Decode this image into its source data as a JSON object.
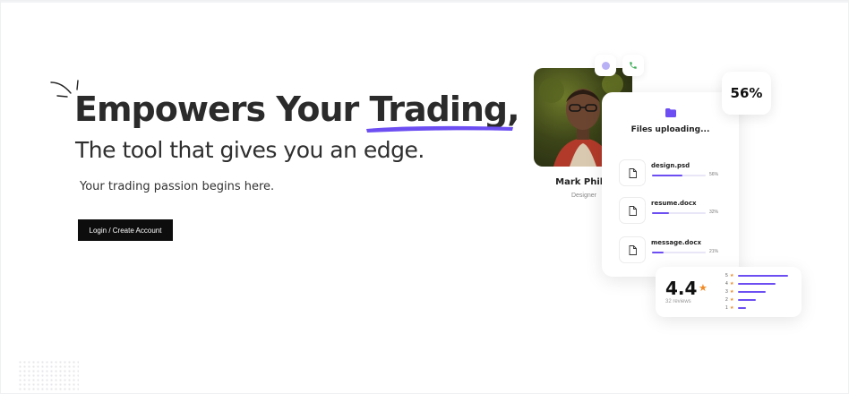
{
  "hero": {
    "headline_prefix": "Empowers Your ",
    "headline_highlight": "Trading",
    "headline_suffix": ",",
    "subheadline": "The tool that gives you an edge.",
    "tagline": "Your trading passion begins here.",
    "cta_label": "Login / Create Account"
  },
  "profile": {
    "name": "Mark Philip",
    "role": "Designer"
  },
  "upload": {
    "title": "Files uploading...",
    "percent_badge": "56%",
    "files": [
      {
        "name": "design.psd",
        "percent_label": "56%",
        "progress": 0.56
      },
      {
        "name": "resume.docx",
        "percent_label": "32%",
        "progress": 0.32
      },
      {
        "name": "message.docx",
        "percent_label": "21%",
        "progress": 0.21
      }
    ]
  },
  "reviews": {
    "rating": "4.4",
    "count_label": "32 reviews",
    "distribution": [
      {
        "stars": "5",
        "share": 0.9
      },
      {
        "stars": "4",
        "share": 0.67
      },
      {
        "stars": "3",
        "share": 0.5
      },
      {
        "stars": "2",
        "share": 0.32
      },
      {
        "stars": "1",
        "share": 0.15
      }
    ]
  },
  "colors": {
    "accent": "#6c4ef2",
    "star": "#f08a24",
    "cta_background": "#0d0d0d"
  },
  "icons": [
    "video-call-icon",
    "phone-icon",
    "folder-icon",
    "file-icon",
    "star-icon",
    "sparkle-lines-icon"
  ]
}
